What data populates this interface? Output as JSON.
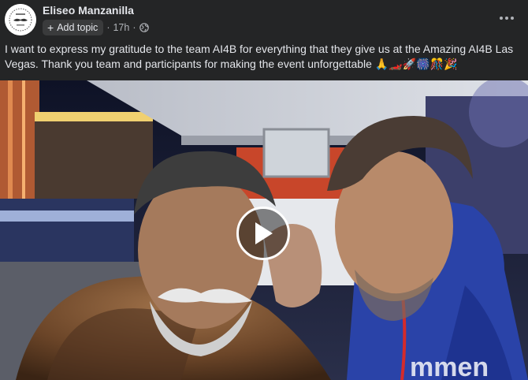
{
  "post": {
    "author": "Eliseo Manzanilla",
    "add_topic_label": "Add topic",
    "timestamp": "17h",
    "separator": "·",
    "visibility_icon": "globe-icon",
    "text": "I want to express my gratitude to the team AI4B for everything that they give us at the Amazing AI4B Las Vegas. Thank you team and participants for making the event unforgettable",
    "emojis": "🙏🏎️🚀🎆🎊🎉"
  },
  "icons": {
    "more": "more-options-icon",
    "play": "play-icon"
  },
  "colors": {
    "background": "#242526",
    "text_primary": "#e4e6eb",
    "text_secondary": "#b0b3b8",
    "chip_bg": "#3a3b3c"
  }
}
